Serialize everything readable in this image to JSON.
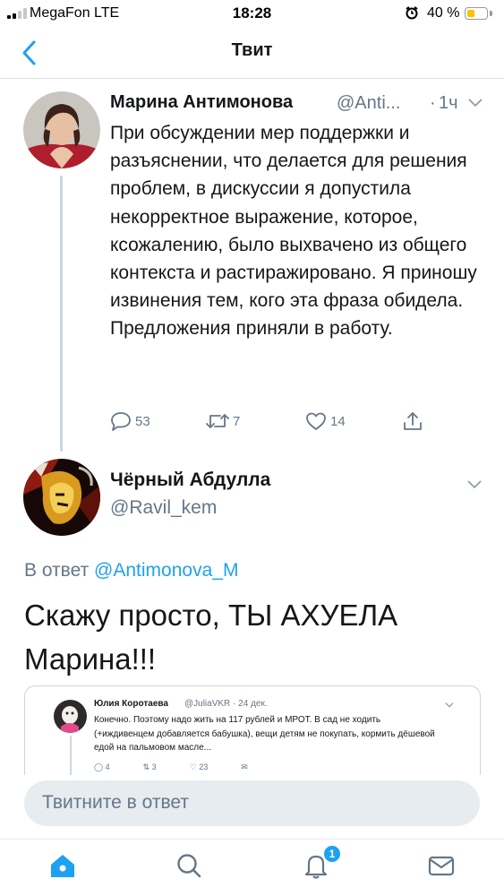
{
  "status_bar": {
    "carrier": "MegaFon  LTE",
    "time": "18:28",
    "battery_percent": "40 %",
    "battery_level": 0.4,
    "battery_color": "#f6c600"
  },
  "nav": {
    "title": "Твит",
    "back_icon": "chevron-left-icon"
  },
  "tweet": {
    "author_name": "Марина Антимонова",
    "handle": "@Anti...",
    "dot": "·",
    "time": "1ч",
    "text": "При обсуждении мер поддержки и разъяснении, что делается для решения проблем, в дискуссии я допустила некорректное выражение, которое, ксожалению, было выхвачено из общего контекста и растиражировано. Я приношу извинения тем, кого эта фраза обидела. Предложения приняли в работу.",
    "replies": "53",
    "retweets": "7",
    "likes": "14"
  },
  "reply": {
    "author_name": "Чёрный Абдулла",
    "handle": "@Ravil_kem",
    "reply_prefix": "В ответ",
    "reply_to": "@Antimonova_M",
    "text": "Скажу просто,  ТЫ АХУЕЛА Марина!!!"
  },
  "quoted_tweet": {
    "author_name": "Юлия Коротаева",
    "meta": "@JuliaVKR · 24 дек.",
    "text": "Конечно. Поэтому надо жить на 117 рублей и МРОТ. В сад не ходить (+иждивенцем добавляется бабушка), вещи детям не покупать, кормить дёшевой едой на пальмовом масле...",
    "replies": "4",
    "retweets": "3",
    "likes": "23"
  },
  "reply_box": {
    "placeholder": "Твитните в ответ"
  },
  "tab_bar": {
    "notification_badge": "1",
    "accent_color": "#1da1f2",
    "icons": [
      "home-icon",
      "search-icon",
      "bell-icon",
      "mail-icon"
    ]
  }
}
